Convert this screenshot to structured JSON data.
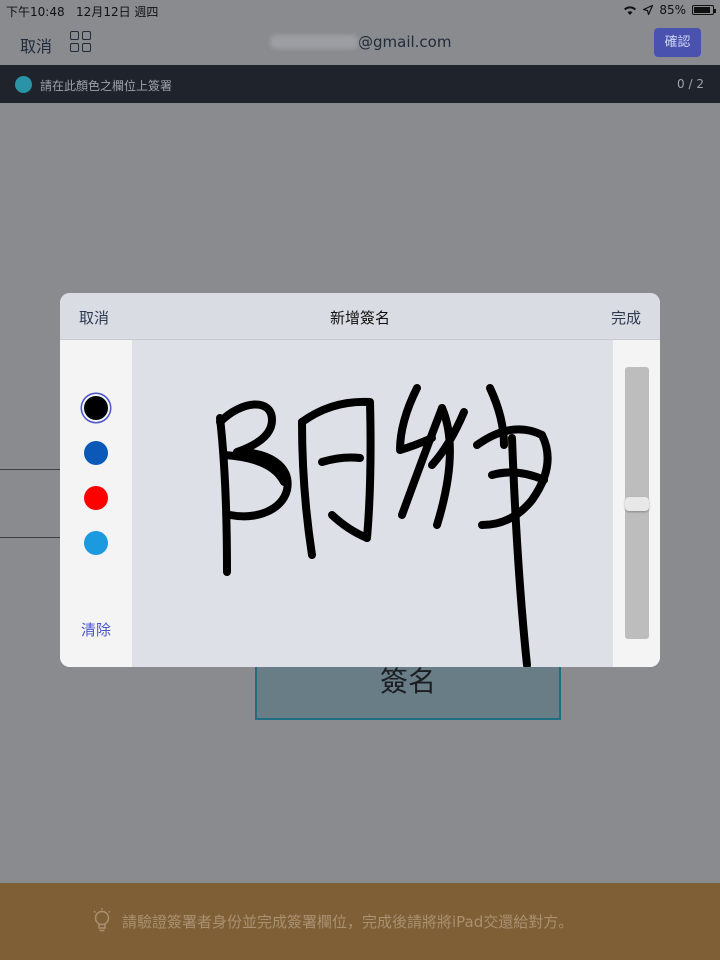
{
  "status_bar": {
    "time": "下午10:48",
    "date": "12月12日 週四",
    "battery": "85%",
    "icons": [
      "wifi-icon",
      "location-icon",
      "battery-icon"
    ]
  },
  "nav": {
    "cancel_label": "取消",
    "email_visible": "@gmail.com",
    "confirm_label": "確認"
  },
  "info_bar": {
    "text": "請在此顏色之欄位上簽署",
    "indicator_color": "#2a93a6",
    "count": "0 / 2"
  },
  "background": {
    "signature_field_label": "簽名",
    "signature_field_color": "#687d86"
  },
  "bottom_bar": {
    "message": "請驗證簽署者身份並完成簽署欄位，完成後請將將iPad交還給對方。",
    "icon": "lightbulb-icon"
  },
  "modal": {
    "cancel_label": "取消",
    "title": "新增簽名",
    "done_label": "完成",
    "clear_label": "清除",
    "colors": [
      "#000000",
      "#0a58b7",
      "#ff0000",
      "#1b9ae0"
    ],
    "selected_color": "#000000",
    "stroke_width_level": 0.5
  }
}
